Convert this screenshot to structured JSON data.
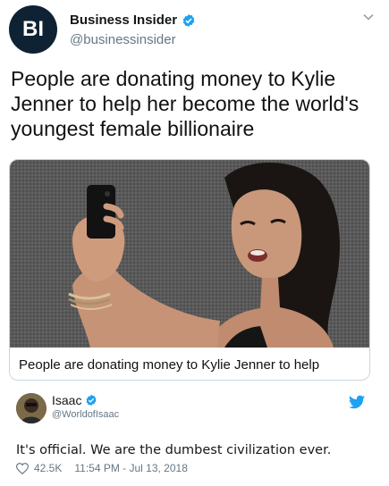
{
  "tweet": {
    "avatar_text": "BI",
    "display_name": "Business Insider",
    "handle": "@businessinsider",
    "text": "People are donating money to Kylie Jenner to help her become the world's youngest female billionaire",
    "card": {
      "image_icon": "photo-woman-selfie",
      "caption": "People are donating money to Kylie Jenner to help"
    }
  },
  "quote": {
    "display_name": "Isaac",
    "handle": "@WorldofIsaac",
    "text": "It's official. We are the dumbest civilization ever.",
    "likes": "42.5K",
    "timestamp": "11:54 PM - Jul 13, 2018"
  },
  "colors": {
    "verified": "#1da1f2",
    "bi_avatar": "#0f2233",
    "twitter_bird": "#1da1f2",
    "muted_text": "#657786"
  }
}
